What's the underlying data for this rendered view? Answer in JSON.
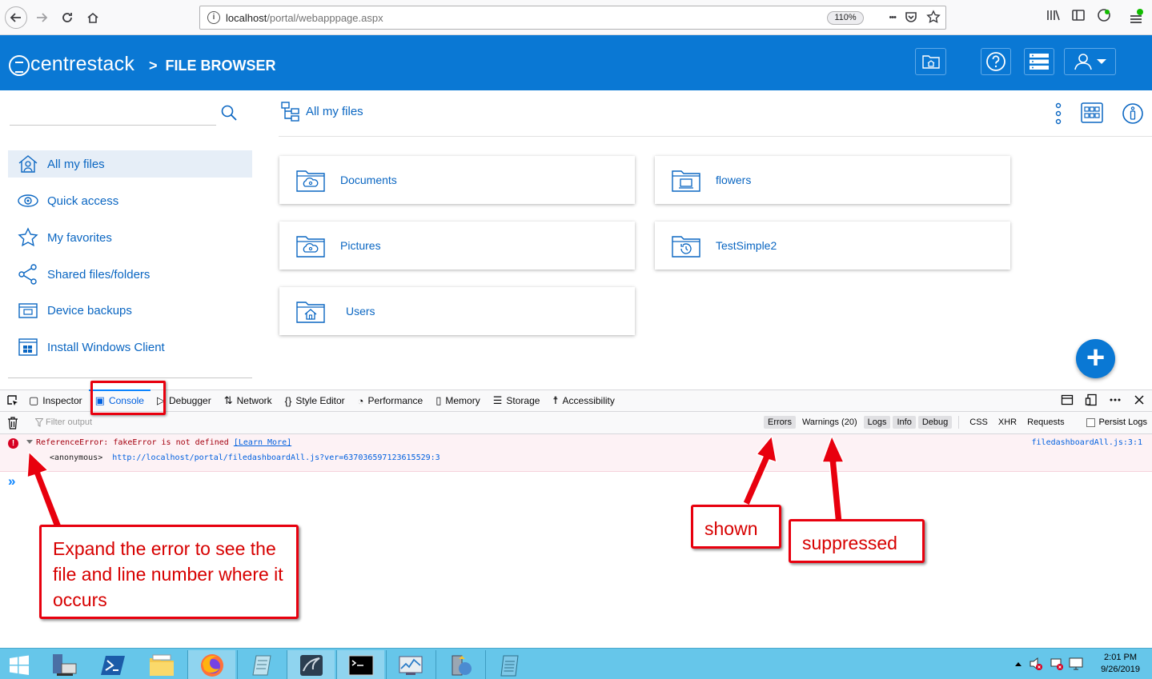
{
  "browser": {
    "url_host": "localhost",
    "url_path": "/portal/webapppage.aspx",
    "zoom": "110%",
    "more_glyph": "•••"
  },
  "app": {
    "logo": "centrestack",
    "crumb_sep": ">",
    "page_title": "FILE BROWSER"
  },
  "sidebar": {
    "items": [
      {
        "label": "All my files",
        "icon": "home-person-icon"
      },
      {
        "label": "Quick access",
        "icon": "eye-icon"
      },
      {
        "label": "My favorites",
        "icon": "star-icon"
      },
      {
        "label": "Shared files/folders",
        "icon": "share-icon"
      },
      {
        "label": "Device backups",
        "icon": "device-backup-icon"
      },
      {
        "label": "Install Windows Client",
        "icon": "windows-client-icon"
      }
    ]
  },
  "main": {
    "breadcrumb": "All my files",
    "folders": [
      {
        "name": "Documents",
        "icon": "cloud-folder-icon"
      },
      {
        "name": "flowers",
        "icon": "computer-folder-icon"
      },
      {
        "name": "Pictures",
        "icon": "cloud-folder-icon"
      },
      {
        "name": "TestSimple2",
        "icon": "history-folder-icon"
      },
      {
        "name": "Users",
        "icon": "home-folder-icon"
      }
    ],
    "fab_label": "+"
  },
  "devtools": {
    "tabs": [
      {
        "label": "Inspector",
        "glyph": "▢"
      },
      {
        "label": "Console",
        "glyph": "▣"
      },
      {
        "label": "Debugger",
        "glyph": "▷"
      },
      {
        "label": "Network",
        "glyph": "⇅"
      },
      {
        "label": "Style Editor",
        "glyph": "{}"
      },
      {
        "label": "Performance",
        "glyph": "◔"
      },
      {
        "label": "Memory",
        "glyph": "▯"
      },
      {
        "label": "Storage",
        "glyph": "☰"
      },
      {
        "label": "Accessibility",
        "glyph": "☨"
      }
    ],
    "filter_placeholder": "Filter output",
    "filters": [
      {
        "label": "Errors",
        "on": true
      },
      {
        "label": "Warnings (20)",
        "on": false
      },
      {
        "label": "Logs",
        "on": true
      },
      {
        "label": "Info",
        "on": true
      },
      {
        "label": "Debug",
        "on": true
      }
    ],
    "net_filters": [
      "CSS",
      "XHR",
      "Requests"
    ],
    "persist_logs": "Persist Logs",
    "error": {
      "message": "ReferenceError: fakeError is not defined",
      "learn_more": "[Learn More]",
      "stack_fn": "<anonymous>",
      "stack_url": "http://localhost/portal/filedashboardAll.js?ver=637036597123615529:3",
      "location": "filedashboardAll.js:3:1"
    },
    "prompt": "»"
  },
  "annotations": {
    "expand": "Expand the error to see the file and line number where it occurs",
    "shown": "shown",
    "suppressed": "suppressed"
  },
  "taskbar": {
    "time": "2:01 PM",
    "date": "9/26/2019"
  },
  "colors": {
    "brand_blue": "#0a78d4",
    "link_blue": "#0a66c2",
    "annotation_red": "#e8000e",
    "taskbar": "#66c6ea"
  }
}
